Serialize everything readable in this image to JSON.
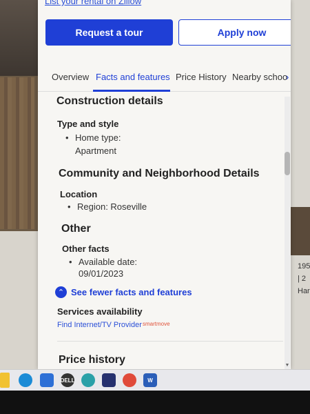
{
  "top_link": "List your rental on Zillow",
  "actions": {
    "request_tour": "Request a tour",
    "apply_now": "Apply now"
  },
  "tabs": [
    {
      "label": "Overview"
    },
    {
      "label": "Facts and features"
    },
    {
      "label": "Price History"
    },
    {
      "label": "Nearby schoo"
    }
  ],
  "construction": {
    "heading": "Construction details",
    "type_style_label": "Type and style",
    "home_type_label": "Home type:",
    "home_type_value": "Apartment"
  },
  "community": {
    "heading": "Community and Neighborhood Details",
    "location_label": "Location",
    "region": "Region: Roseville"
  },
  "other": {
    "heading": "Other",
    "other_facts_label": "Other facts",
    "available_date_label": "Available date:",
    "available_date_value": "09/01/2023"
  },
  "toggle_label": "See fewer facts and features",
  "services": {
    "heading": "Services availability",
    "link": "Find Internet/TV Provider",
    "brand": "smartmove"
  },
  "price_history": {
    "heading": "Price history"
  },
  "right_snippets": {
    "a": "195",
    "b": "| 2",
    "c": "Har"
  },
  "taskbar_icons": [
    "file-explorer-icon",
    "edge-icon",
    "store-icon",
    "dell-icon",
    "app-icon",
    "dell-support-icon",
    "chrome-icon",
    "word-icon"
  ],
  "colors": {
    "accent": "#1f3fd6",
    "panel_bg": "#f7f6f3"
  }
}
